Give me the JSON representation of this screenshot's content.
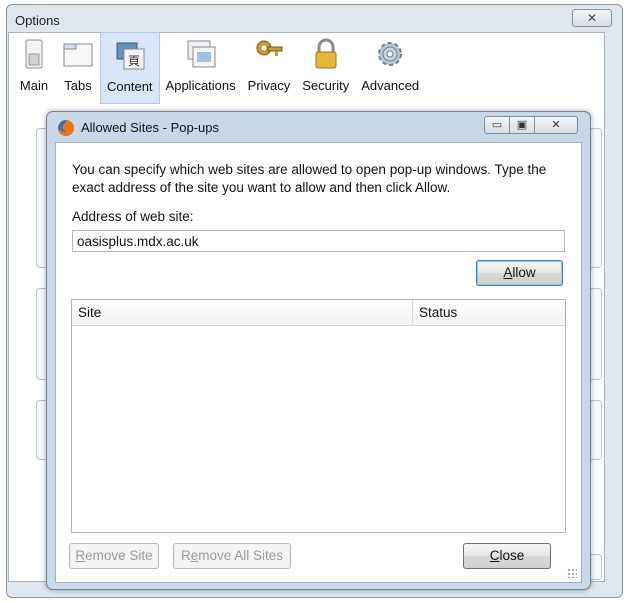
{
  "options_window": {
    "title": "Options",
    "close_glyph": "✕",
    "toolbar": [
      {
        "label": "Main",
        "icon": "switch-icon",
        "active": false
      },
      {
        "label": "Tabs",
        "icon": "tabs-icon",
        "active": false
      },
      {
        "label": "Content",
        "icon": "content-icon",
        "active": true
      },
      {
        "label": "Applications",
        "icon": "applications-icon",
        "active": false
      },
      {
        "label": "Privacy",
        "icon": "privacy-key-icon",
        "active": false
      },
      {
        "label": "Security",
        "icon": "security-lock-icon",
        "active": false
      },
      {
        "label": "Advanced",
        "icon": "gear-icon",
        "active": false
      }
    ]
  },
  "dialog": {
    "title": "Allowed Sites - Pop-ups",
    "description": "You can specify which web sites are allowed to open pop-up windows. Type the exact address of the site you want to allow and then click Allow.",
    "address_label": "Address of web site:",
    "address_value": "oasisplus.mdx.ac.uk",
    "allow_button": {
      "accel": "A",
      "rest": "llow"
    },
    "table": {
      "columns": [
        "Site",
        "Status"
      ],
      "rows": []
    },
    "remove_site_button": {
      "accel": "R",
      "rest": "emove Site"
    },
    "remove_all_button": {
      "pre": "R",
      "accel": "e",
      "rest": "move All Sites"
    },
    "close_button": {
      "accel": "C",
      "rest": "lose"
    }
  },
  "colors": {
    "accent": "#3c7fb1",
    "window_frame": "#c9d8e8",
    "active_tab": "#d9e6f7"
  }
}
